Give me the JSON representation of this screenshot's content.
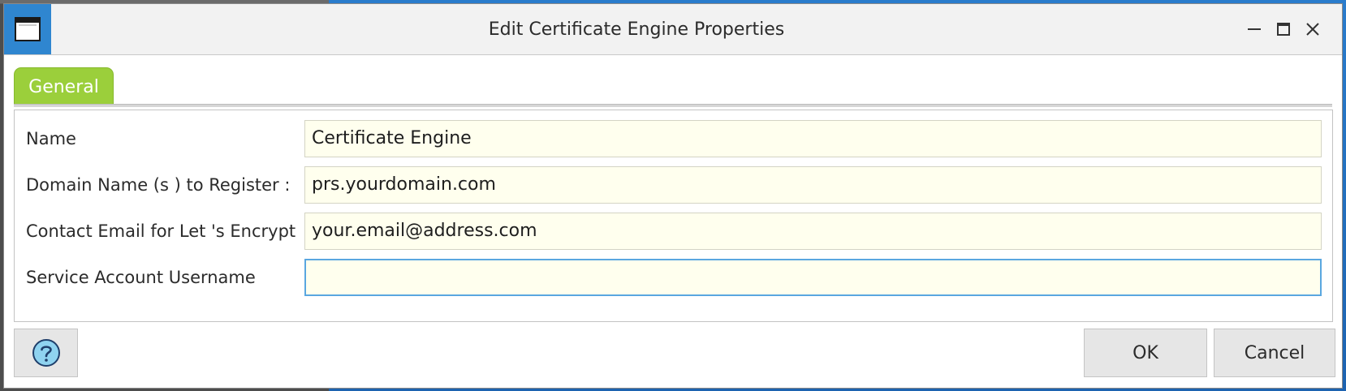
{
  "window": {
    "title": "Edit Certificate Engine Properties"
  },
  "tabs": [
    {
      "label": "General",
      "active": true
    }
  ],
  "form": {
    "fields": [
      {
        "label": "Name",
        "value": "Certificate Engine"
      },
      {
        "label": "Domain Name (s ) to Register :",
        "value": "prs.yourdomain.com"
      },
      {
        "label": "Contact Email for Let 's Encrypt",
        "value": "your.email@address.com"
      },
      {
        "label": "Service Account Username",
        "value": ""
      }
    ]
  },
  "footer": {
    "ok_label": "OK",
    "cancel_label": "Cancel"
  },
  "icons": {
    "app": "window-icon",
    "minimize": "minimize-icon",
    "maximize": "maximize-icon",
    "close": "close-icon",
    "help": "help-icon"
  },
  "colors": {
    "accent_tab": "#9bcf3b",
    "field_background": "#ffffee",
    "app_icon_background": "#2f86d0",
    "focus_border": "#5aa7e0"
  }
}
